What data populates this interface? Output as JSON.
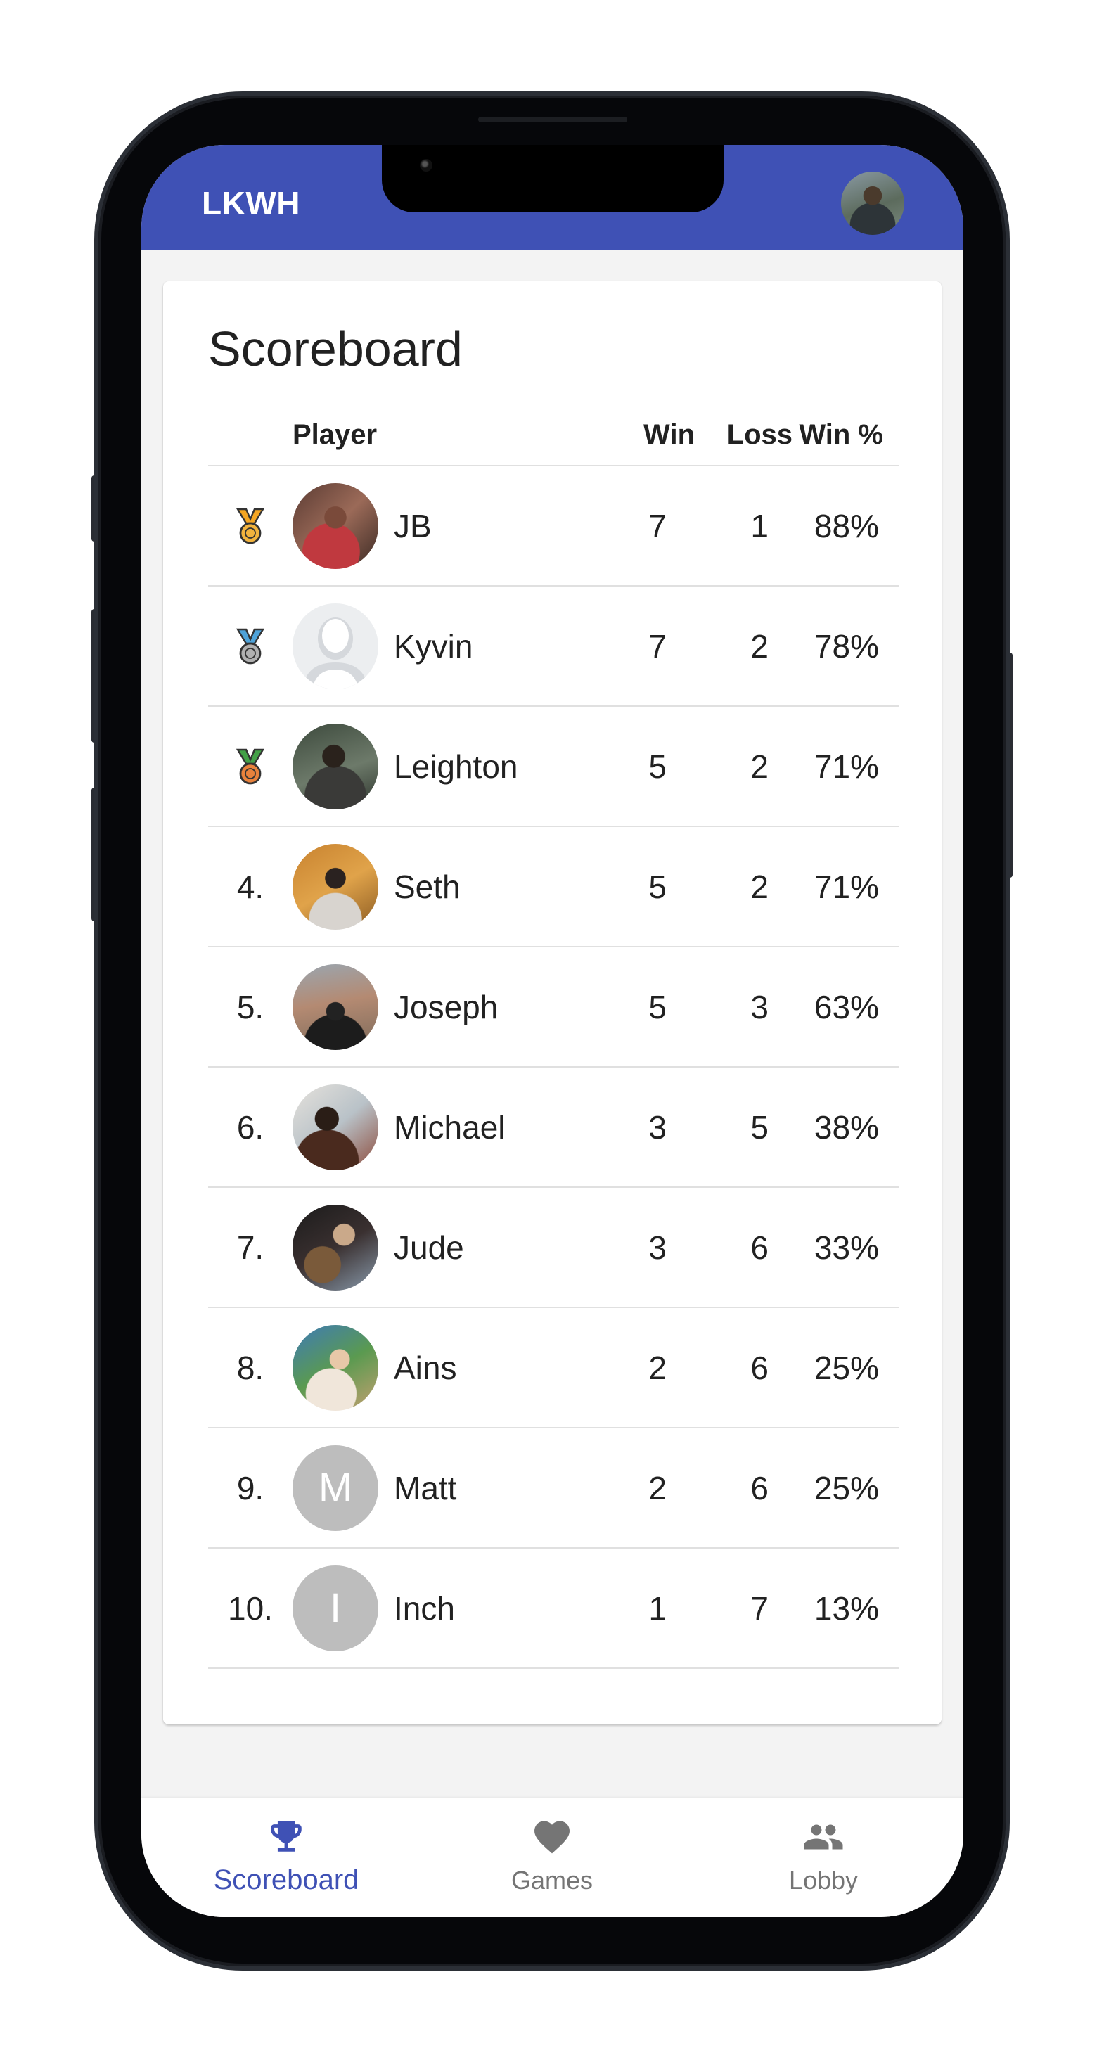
{
  "app": {
    "title": "LKWH"
  },
  "scoreboard": {
    "title": "Scoreboard",
    "columns": {
      "player": "Player",
      "win": "Win",
      "loss": "Loss",
      "pct": "Win %"
    },
    "rows": [
      {
        "rank": "",
        "medal": "gold",
        "name": "JB",
        "win": "7",
        "loss": "1",
        "pct": "88%",
        "avatar": "photo-a"
      },
      {
        "rank": "",
        "medal": "silver",
        "name": "Kyvin",
        "win": "7",
        "loss": "2",
        "pct": "78%",
        "avatar": "placeholder"
      },
      {
        "rank": "",
        "medal": "bronze",
        "name": "Leighton",
        "win": "5",
        "loss": "2",
        "pct": "71%",
        "avatar": "photo-c"
      },
      {
        "rank": "4.",
        "medal": "",
        "name": "Seth",
        "win": "5",
        "loss": "2",
        "pct": "71%",
        "avatar": "photo-d"
      },
      {
        "rank": "5.",
        "medal": "",
        "name": "Joseph",
        "win": "5",
        "loss": "3",
        "pct": "63%",
        "avatar": "photo-e"
      },
      {
        "rank": "6.",
        "medal": "",
        "name": "Michael",
        "win": "3",
        "loss": "5",
        "pct": "38%",
        "avatar": "photo-f"
      },
      {
        "rank": "7.",
        "medal": "",
        "name": "Jude",
        "win": "3",
        "loss": "6",
        "pct": "33%",
        "avatar": "photo-g"
      },
      {
        "rank": "8.",
        "medal": "",
        "name": "Ains",
        "win": "2",
        "loss": "6",
        "pct": "25%",
        "avatar": "photo-h"
      },
      {
        "rank": "9.",
        "medal": "",
        "name": "Matt",
        "win": "2",
        "loss": "6",
        "pct": "25%",
        "avatar": "letter",
        "letter": "M"
      },
      {
        "rank": "10.",
        "medal": "",
        "name": "Inch",
        "win": "1",
        "loss": "7",
        "pct": "13%",
        "avatar": "letter",
        "letter": "I"
      }
    ]
  },
  "nav": {
    "items": [
      {
        "label": "Scoreboard",
        "icon": "trophy-icon",
        "active": true
      },
      {
        "label": "Games",
        "icon": "heart-icon",
        "active": false
      },
      {
        "label": "Lobby",
        "icon": "people-icon",
        "active": false
      }
    ]
  },
  "colors": {
    "primary": "#3f51b5",
    "inactive": "#757575",
    "gold": "#f5a623",
    "silver": "#4fa3d9",
    "bronze": "#43a047"
  }
}
